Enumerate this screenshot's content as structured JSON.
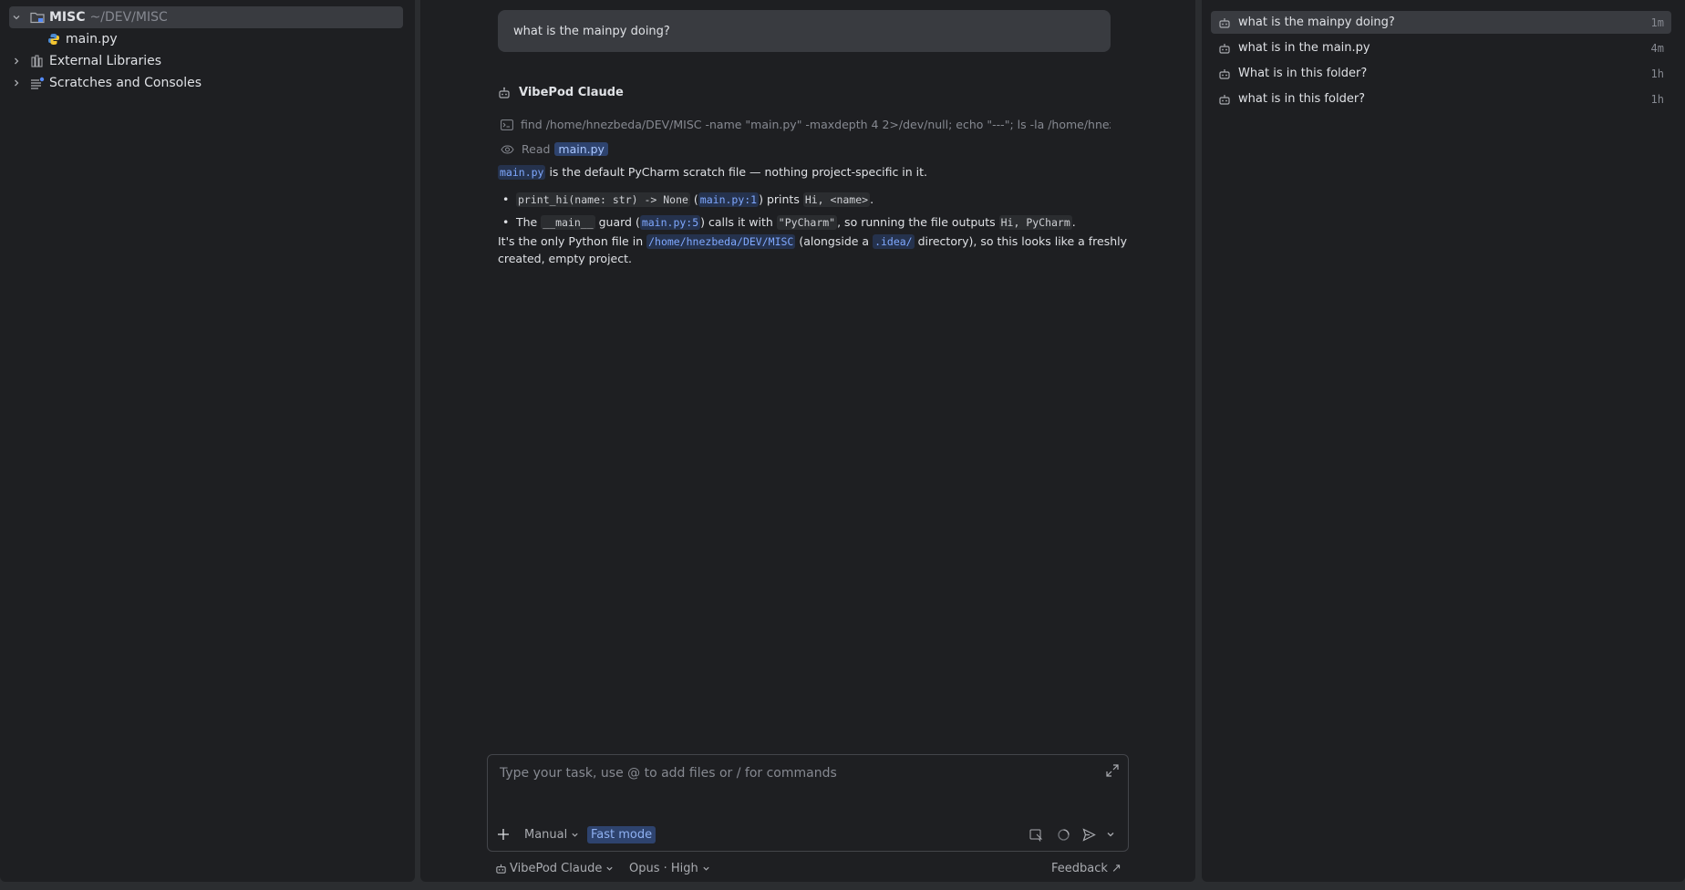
{
  "project": {
    "root_name": "MISC",
    "root_path": "~/DEV/MISC",
    "file": "main.py",
    "external_libraries": "External Libraries",
    "scratches": "Scratches and Consoles"
  },
  "chat": {
    "user_message": "what is the mainpy doing?",
    "assistant_name": "VibePod Claude",
    "tool_command": "find /home/hnezbeda/DEV/MISC -name \"main.py\" -maxdepth 4 2>/dev/null; echo \"---\"; ls -la /home/hnezbeda/DEV/MISC",
    "read_label": "Read",
    "read_file": "main.py",
    "answer": {
      "intro_code": "main.py",
      "intro_text": " is the default PyCharm scratch file — nothing project-specific in it.",
      "b1_code": "print_hi(name: str) -> None",
      "b1_t1": " (",
      "b1_link": "main.py:1",
      "b1_t2": ") prints ",
      "b1_code2": "Hi, <name>",
      "b1_t3": ".",
      "b2_t0": "The ",
      "b2_code": "__main__",
      "b2_t1": " guard (",
      "b2_link": "main.py:5",
      "b2_t2": ") calls it with ",
      "b2_code2": "\"PyCharm\"",
      "b2_t3": ", so running the file outputs ",
      "b2_code3": "Hi, PyCharm",
      "b2_t4": ".",
      "p_t0": "It's the only Python file in ",
      "p_link": "/home/hnezbeda/DEV/MISC",
      "p_t1": " (alongside a ",
      "p_code": ".idea/",
      "p_t2": " directory), so this looks like a freshly",
      "p_line2": "created, empty project."
    },
    "input_placeholder": "Type your task, use @ to add files or / for commands",
    "mode": "Manual",
    "fast_mode": "Fast mode",
    "agent": "VibePod Claude",
    "model": "Opus · High",
    "feedback": "Feedback ↗"
  },
  "history": [
    {
      "title": "what is the mainpy doing?",
      "time": "1m"
    },
    {
      "title": "what is in the main.py",
      "time": "4m"
    },
    {
      "title": "What is in this folder?",
      "time": "1h"
    },
    {
      "title": "what is in this folder?",
      "time": "1h"
    }
  ],
  "colors": {
    "background": "#1e1f22",
    "selection": "#393b40",
    "accent": "#2e436e",
    "link": "#7fa8ff"
  }
}
